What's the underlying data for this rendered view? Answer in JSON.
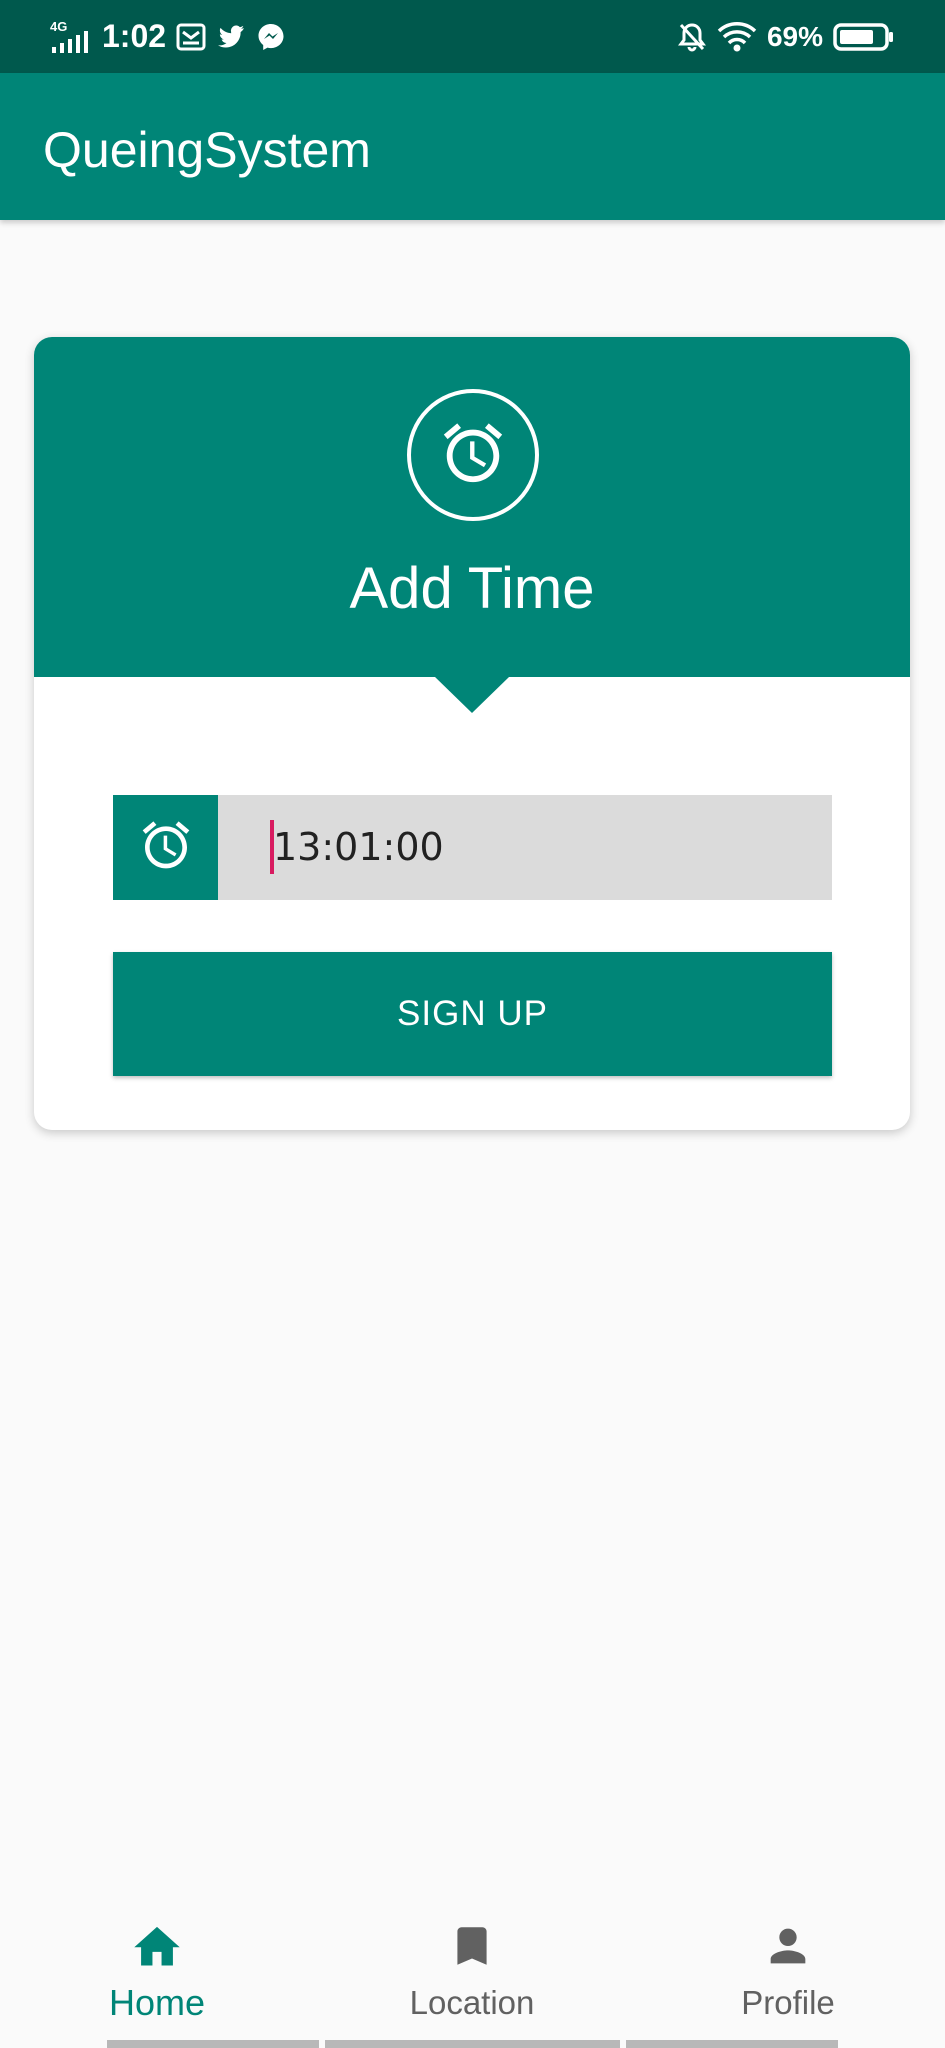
{
  "status_bar": {
    "network": "4G",
    "time": "1:02",
    "battery": "69%",
    "notification_icons": [
      "mail-icon",
      "twitter-icon",
      "messenger-icon"
    ],
    "right_icons": [
      "bell-off-icon",
      "wifi-icon",
      "battery-icon"
    ]
  },
  "app_bar": {
    "title": "QueingSystem"
  },
  "card": {
    "title": "Add Time",
    "header_icon": "alarm-clock-icon",
    "time_field": {
      "icon": "alarm-clock-icon",
      "value": "13:01:00"
    },
    "button_label": "SIGN UP"
  },
  "bottom_nav": {
    "items": [
      {
        "label": "Home",
        "icon": "home-icon",
        "active": true
      },
      {
        "label": "Location",
        "icon": "bookmark-icon",
        "active": false
      },
      {
        "label": "Profile",
        "icon": "person-icon",
        "active": false
      }
    ]
  },
  "colors": {
    "primary": "#008577",
    "primary_dark": "#00594d",
    "accent": "#d81b60",
    "background": "#fafafa"
  }
}
